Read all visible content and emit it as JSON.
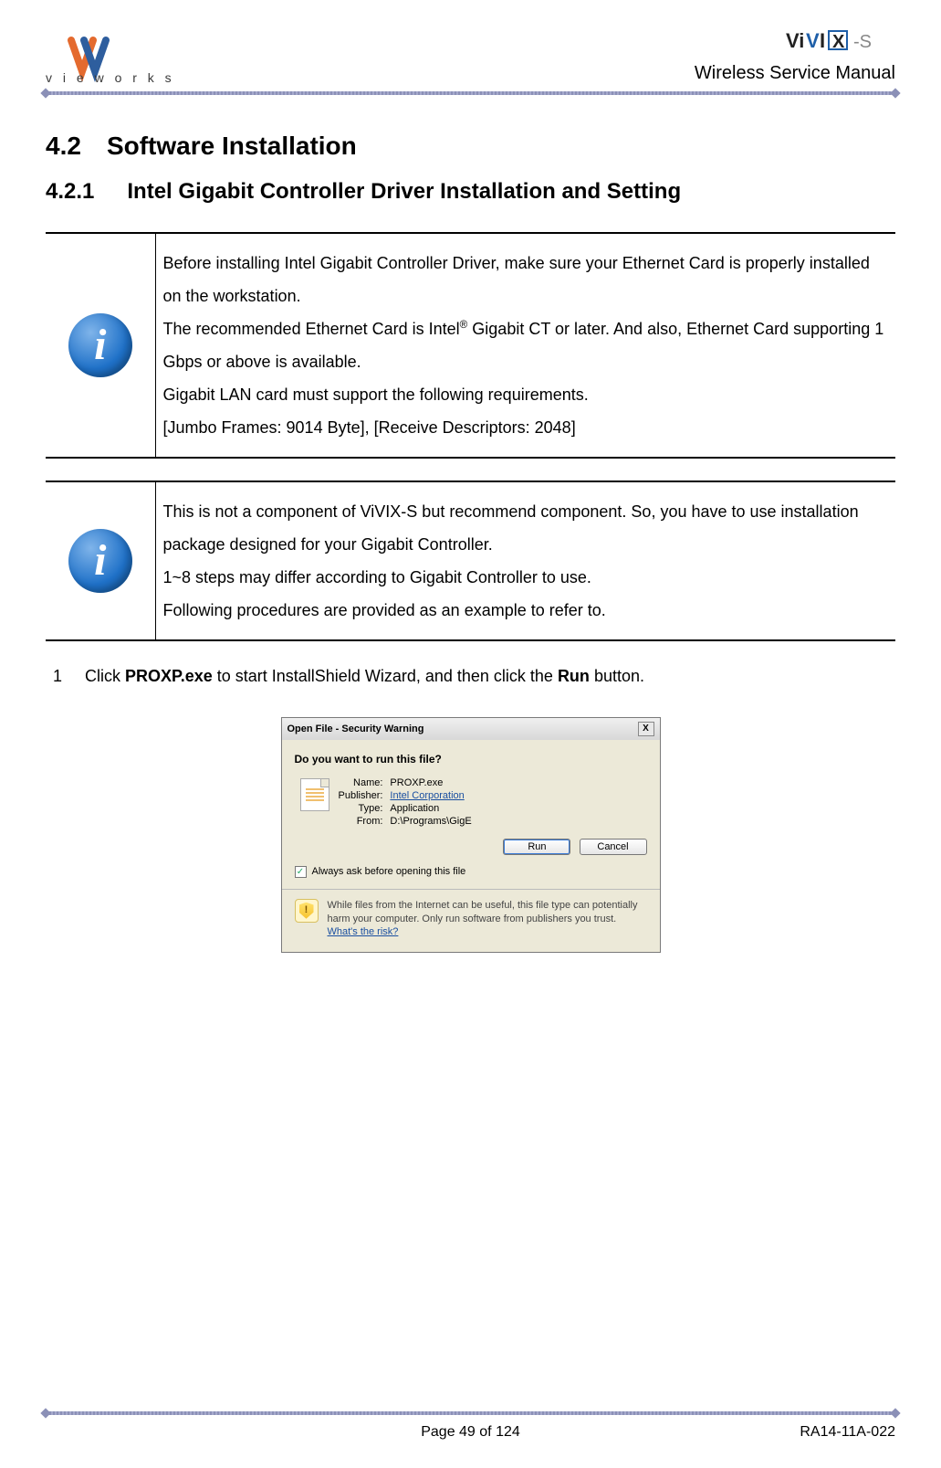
{
  "header": {
    "brand_text": "vieworks",
    "product_logo_text": "ViVIX",
    "product_logo_suffix": "-S",
    "manual_title": "Wireless Service Manual"
  },
  "sections": {
    "major_num": "4.2",
    "major_title": "Software Installation",
    "minor_num": "4.2.1",
    "minor_title": "Intel Gigabit Controller Driver Installation and Setting"
  },
  "info_boxes": [
    {
      "paragraphs": [
        "Before installing Intel Gigabit Controller Driver, make sure your Ethernet Card is properly installed on the workstation.",
        "The recommended Ethernet Card is Intel® Gigabit CT or later. And also, Ethernet Card supporting 1 Gbps or above is available.",
        "Gigabit LAN card must support the following requirements.",
        "[Jumbo Frames: 9014 Byte], [Receive Descriptors: 2048]"
      ]
    },
    {
      "paragraphs": [
        "This is not a component of ViVIX-S but recommend component. So, you have to use installation package designed for your Gigabit Controller.",
        "1~8 steps may differ according to Gigabit Controller to use.",
        "Following procedures are provided as an example to refer to."
      ]
    }
  ],
  "step": {
    "num": "1",
    "pre": "Click ",
    "bold1": "PROXP.exe",
    "mid": " to start InstallShield Wizard, and then click the ",
    "bold2": "Run",
    "post": " button."
  },
  "dialog": {
    "title": "Open File - Security Warning",
    "close": "X",
    "question": "Do you want to run this file?",
    "fields": {
      "name_label": "Name:",
      "name_value": "PROXP.exe",
      "publisher_label": "Publisher:",
      "publisher_value": "Intel Corporation",
      "type_label": "Type:",
      "type_value": "Application",
      "from_label": "From:",
      "from_value": "D:\\Programs\\GigE"
    },
    "buttons": {
      "run": "Run",
      "cancel": "Cancel"
    },
    "checkbox_label": "Always ask before opening this file",
    "checkbox_checked": "✓",
    "warning_text": "While files from the Internet can be useful, this file type can potentially harm your computer. Only run software from publishers you trust. ",
    "warning_link": "What's the risk?",
    "shield_mark": "!"
  },
  "footer": {
    "page": "Page 49 of 124",
    "doc_id": "RA14-11A-022"
  }
}
